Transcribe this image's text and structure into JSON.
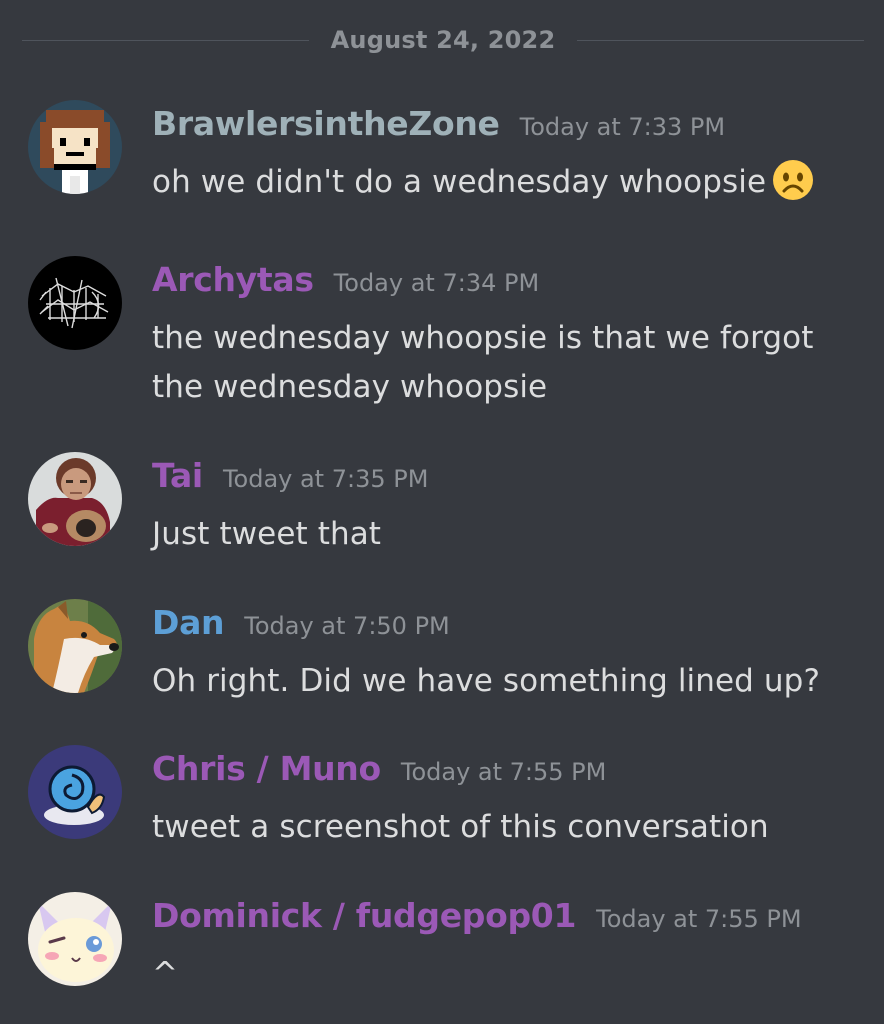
{
  "date_divider": "August 24, 2022",
  "colors": {
    "background": "#36393f",
    "username_purple": "#9b59b6",
    "username_blue": "#5d9fd6",
    "timestamp": "#8e9297",
    "text": "#dcddde"
  },
  "messages": [
    {
      "username": "BrawlersintheZone",
      "username_color": "#9fb1b8",
      "timestamp": "Today at 7:33 PM",
      "lines": [
        "oh we didn't do a wednesday whoopsie"
      ],
      "emoji": "frowning-face-icon",
      "avatar": "pixel-character-avatar"
    },
    {
      "username": "Archytas",
      "username_color": "#9b59b6",
      "timestamp": "Today at 7:34 PM",
      "lines": [
        "the wednesday whoopsie is that we forgot",
        "the wednesday whoopsie"
      ],
      "avatar": "sketch-drawing-avatar"
    },
    {
      "username": "Tai",
      "username_color": "#9b59b6",
      "timestamp": "Today at 7:35 PM",
      "lines": [
        "Just tweet that"
      ],
      "avatar": "person-with-dog-avatar"
    },
    {
      "username": "Dan",
      "username_color": "#5d9fd6",
      "timestamp": "Today at 7:50 PM",
      "lines": [
        "Oh right. Did we have something lined up?"
      ],
      "avatar": "corgi-dog-avatar"
    },
    {
      "username": "Chris / Muno",
      "username_color": "#9b59b6",
      "timestamp": "Today at 7:55 PM",
      "lines": [
        "tweet a screenshot of this conversation"
      ],
      "avatar": "blue-snail-avatar"
    },
    {
      "username": "Dominick / fudgepop01",
      "username_color": "#9b59b6",
      "timestamp": "Today at 7:55 PM",
      "lines": [
        "^"
      ],
      "avatar": "anime-cat-avatar"
    }
  ]
}
